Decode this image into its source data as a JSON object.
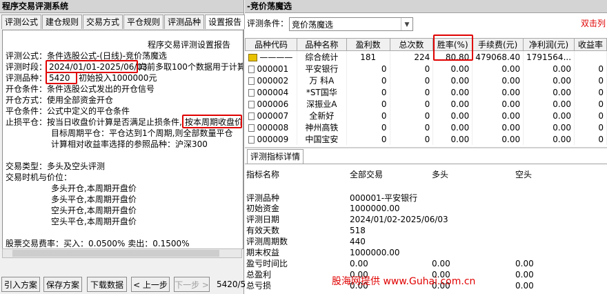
{
  "left": {
    "title": "程序交易评测系统",
    "tabs": [
      "评测公式",
      "建仓规则",
      "交易方式",
      "平仓规则",
      "评测品种",
      "设置报告"
    ],
    "report": {
      "header": "程序交易评测设置报告",
      "formula_label": "评测公式：",
      "formula_value": "条件选股公式-(日线)-竞价荡魔选",
      "period_label": "评测时段：",
      "period_value": "2024/01/01-2025/06/03",
      "period_suffix": "向前多取100个数据用于计算",
      "variety_label": "评测品种：",
      "variety_value": "5420",
      "variety_suffix": "初始投入1000000元",
      "open_cond_label": "开仓条件：",
      "open_cond_value": "条件选股公式发出的开仓信号",
      "open_mode_label": "开仓方式：",
      "open_mode_value": "使用全部资金开仓",
      "close_cond_label": "平仓条件：",
      "close_cond_value": "公式中定义的平仓条件",
      "stoploss_label": "止损平仓：",
      "stoploss_value": "按当日收盘价计算是否满足止损条件,",
      "stoploss_highlight": "按本周期收盘价",
      "target_label": "目标周期平仓：",
      "target_value": "平仓达到1个周期,则全部数量平仓",
      "benchmark": "计算相对收益率选择的参照品种：沪深300",
      "trade_type": "交易类型：多头及空头评测",
      "trade_time": "交易时机与价位：",
      "timing": [
        "多头开仓,本周期开盘价",
        "多头平仓,本周期开盘价",
        "空头开仓,本周期开盘价",
        "空头平仓,本周期开盘价"
      ],
      "fee": "股票交易费率：买入：0.0500%  卖出：0.1500%"
    },
    "buttons": {
      "import": "引入方案",
      "save": "保存方案",
      "download": "下载数据",
      "prev": "< 上一步",
      "next": "下一步 >",
      "progress": "5420/5"
    }
  },
  "right": {
    "title": "-竞价荡魔选",
    "cond_label": "评测条件：",
    "cond_value": "竞价荡魔选",
    "double_click": "双击列",
    "columns": [
      "品种代码",
      "品种名称",
      "盈利数",
      "总次数",
      "胜率(%)",
      "手续费(元)",
      "净利润(元)",
      "收益率"
    ],
    "rows": [
      {
        "code": "————",
        "name": "综合统计",
        "win": "181",
        "total": "224",
        "rate": "80.80",
        "fee": "479068.40",
        "profit": "1791564...",
        "ret": ""
      },
      {
        "code": "000001",
        "name": "平安银行",
        "win": "0",
        "total": "0",
        "rate": "0.00",
        "fee": "0.00",
        "profit": "0.00",
        "ret": "0"
      },
      {
        "code": "000002",
        "name": "万 科A",
        "win": "0",
        "total": "0",
        "rate": "0.00",
        "fee": "0.00",
        "profit": "0.00",
        "ret": "0"
      },
      {
        "code": "000004",
        "name": "*ST国华",
        "win": "0",
        "total": "0",
        "rate": "0.00",
        "fee": "0.00",
        "profit": "0.00",
        "ret": "0"
      },
      {
        "code": "000006",
        "name": "深振业A",
        "win": "0",
        "total": "0",
        "rate": "0.00",
        "fee": "0.00",
        "profit": "0.00",
        "ret": "0"
      },
      {
        "code": "000007",
        "name": "全新好",
        "win": "0",
        "total": "0",
        "rate": "0.00",
        "fee": "0.00",
        "profit": "0.00",
        "ret": "0"
      },
      {
        "code": "000008",
        "name": "神州高铁",
        "win": "0",
        "total": "0",
        "rate": "0.00",
        "fee": "0.00",
        "profit": "0.00",
        "ret": "0"
      },
      {
        "code": "000009",
        "name": "中国宝安",
        "win": "0",
        "total": "0",
        "rate": "0.00",
        "fee": "0.00",
        "profit": "0.00",
        "ret": "0"
      }
    ],
    "detail_tab": "评测指标详情",
    "detail_cols": [
      "指标名称",
      "全部交易",
      "多头",
      "空头"
    ],
    "details": [
      {
        "name": "评测品种",
        "all": "000001-平安银行",
        "long": "",
        "short": ""
      },
      {
        "name": "初始资金",
        "all": "1000000.00",
        "long": "",
        "short": ""
      },
      {
        "name": "评测日期",
        "all": "2024/01/02-2025/06/03",
        "long": "",
        "short": ""
      },
      {
        "name": "有效天数",
        "all": "518",
        "long": "",
        "short": ""
      },
      {
        "name": "评测周期数",
        "all": "440",
        "long": "",
        "short": ""
      },
      {
        "name": "期末权益",
        "all": "1000000.00",
        "long": "",
        "short": ""
      },
      {
        "name": "盈亏时间比",
        "all": "0.00",
        "long": "0.00",
        "short": "0.00"
      },
      {
        "name": "总盈利",
        "all": "0.00",
        "long": "0.00",
        "short": "0.00"
      },
      {
        "name": "总亏损",
        "all": "0.00",
        "long": "0.00",
        "short": "0.00"
      }
    ],
    "watermark": "股海网提供  www.Guhai.com.cn"
  }
}
